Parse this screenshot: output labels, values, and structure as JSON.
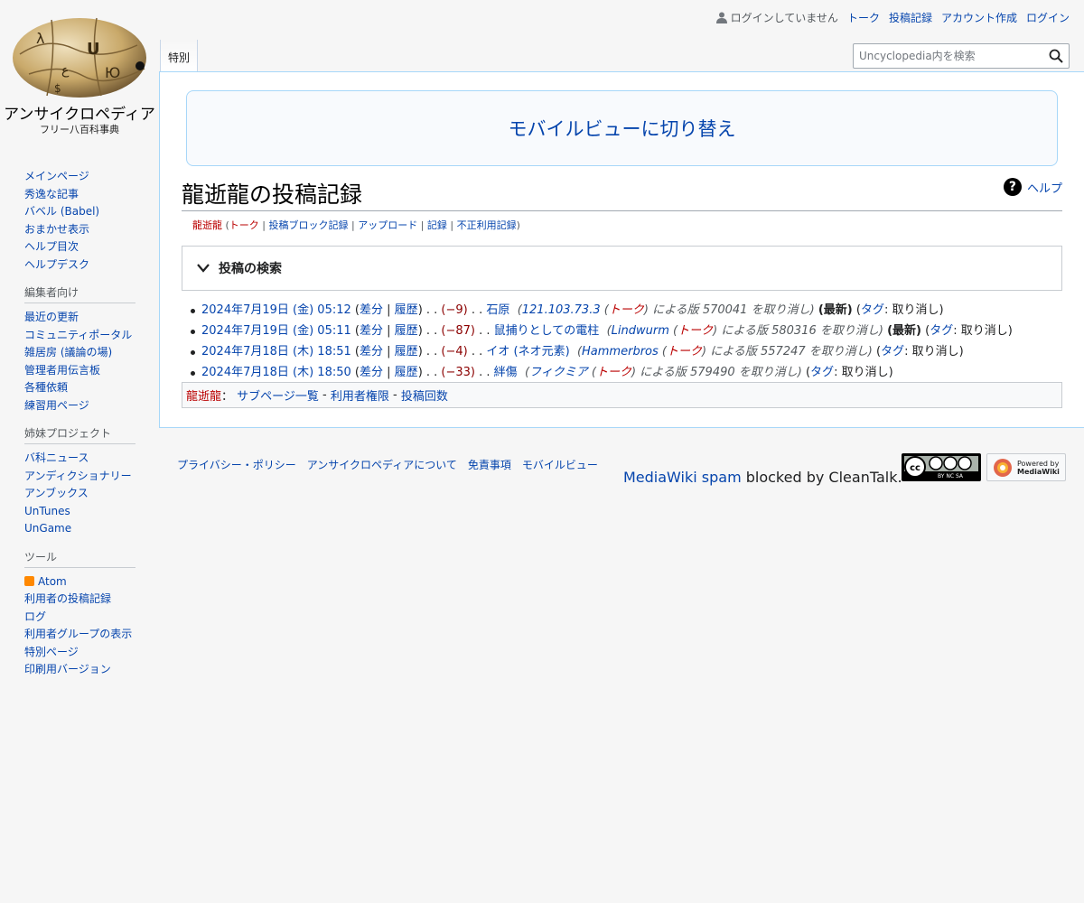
{
  "site": {
    "logo_title": "アンサイクロペディア",
    "logo_tagline": "フリー八百科事典"
  },
  "personal": {
    "status": "ログインしていません",
    "talk": "トーク",
    "contributions": "投稿記録",
    "create_account": "アカウント作成",
    "login": "ログイン"
  },
  "tabs": {
    "special": "特別"
  },
  "search": {
    "placeholder": "Uncyclopedia内を検索"
  },
  "banner": {
    "mobile_view": "モバイルビューに切り替え"
  },
  "page": {
    "title": "龍逝龍の投稿記録",
    "help": "ヘルプ",
    "subtitle": {
      "user": "龍逝龍",
      "talk": "トーク",
      "block_log": "投稿ブロック記録",
      "uploads": "アップロード",
      "logs": "記録",
      "abuse_log": "不正利用記録"
    },
    "search_box_title": "投稿の検索"
  },
  "labels": {
    "diff": "差分",
    "hist": "履歴",
    "tag": "タグ",
    "by": "による版",
    "undo_suffix": "を取り消し",
    "undo": "取り消し",
    "talk": "トーク",
    "latest": "(最新)"
  },
  "contributions": [
    {
      "date": "2024年7月19日 (金) 05:12",
      "size": "(−9)",
      "page": "石原",
      "user": "121.103.73.3",
      "rev": "570041",
      "latest": true
    },
    {
      "date": "2024年7月19日 (金) 05:11",
      "size": "(−87)",
      "page": "鼠捕りとしての電柱",
      "user": "Lindwurm",
      "rev": "580316",
      "latest": true
    },
    {
      "date": "2024年7月18日 (木) 18:51",
      "size": "(−4)",
      "page": "イオ (ネオ元素)",
      "user": "Hammerbros",
      "rev": "557247",
      "latest": false
    },
    {
      "date": "2024年7月18日 (木) 18:50",
      "size": "(−33)",
      "page": "絆傷",
      "user": "フィクミア",
      "rev": "579490",
      "latest": false
    }
  ],
  "user_links": {
    "user": "龍逝龍",
    "subpages": "サブページ一覧",
    "rights": "利用者権限",
    "editcount": "投稿回数"
  },
  "sidebar": {
    "nav": [
      "メインページ",
      "秀逸な記事",
      "バベル (Babel)",
      "おまかせ表示",
      "ヘルプ目次",
      "ヘルプデスク"
    ],
    "editors_heading": "編集者向け",
    "editors": [
      "最近の更新",
      "コミュニティポータル",
      "雑居房 (議論の場)",
      "管理者用伝言板",
      "各種依頼",
      "練習用ページ"
    ],
    "sister_heading": "姉妹プロジェクト",
    "sister": [
      "バ科ニュース",
      "アンディクショナリー",
      "アンブックス",
      "UnTunes",
      "UnGame"
    ],
    "tools_heading": "ツール",
    "tools": [
      "Atom",
      "利用者の投稿記録",
      "ログ",
      "利用者グループの表示",
      "特別ページ",
      "印刷用バージョン"
    ]
  },
  "footer": {
    "privacy": "プライバシー・ポリシー",
    "about": "アンサイクロペディアについて",
    "disclaimer": "免責事項",
    "mobile": "モバイルビュー",
    "cleantalk_link": "MediaWiki spam",
    "cleantalk_rest": " blocked by CleanTalk.",
    "cc_badge": "BY NC SA",
    "mw_badge_1": "Powered by",
    "mw_badge_2": "MediaWiki"
  }
}
